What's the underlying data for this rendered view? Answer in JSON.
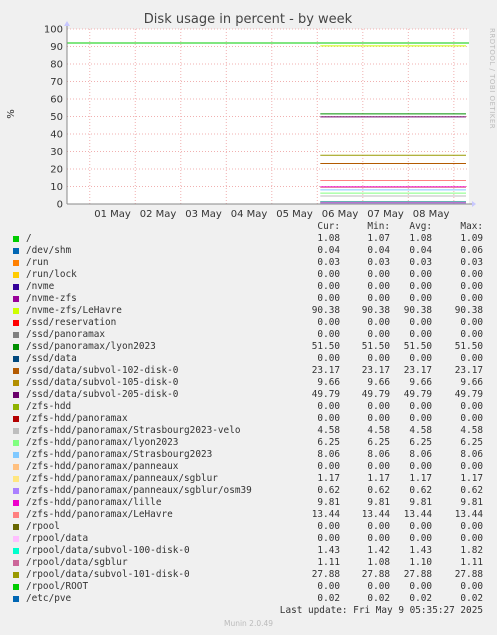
{
  "chart_data": {
    "type": "line",
    "title": "Disk usage in percent - by week",
    "ylabel": "%",
    "side_label": "RRDTOOL / TOBI OETIKER",
    "ylim": [
      0,
      100
    ],
    "y_ticks": [
      0,
      10,
      20,
      30,
      40,
      50,
      60,
      70,
      80,
      90,
      100
    ],
    "x_ticks": [
      "01 May",
      "02 May",
      "03 May",
      "04 May",
      "05 May",
      "06 May",
      "07 May",
      "08 May"
    ],
    "x_range": [
      "30 Apr 12:00",
      "09 May 08:00"
    ],
    "series_start": "06 May",
    "legend_headers": [
      "Cur:",
      "Min:",
      "Avg:",
      "Max:"
    ],
    "series": [
      {
        "name": "/",
        "color": "#00cc00",
        "values": [
          "1.08",
          "1.07",
          "1.08",
          "1.09"
        ]
      },
      {
        "name": "/dev/shm",
        "color": "#0066b3",
        "values": [
          "0.04",
          "0.04",
          "0.04",
          "0.06"
        ]
      },
      {
        "name": "/run",
        "color": "#ff8000",
        "values": [
          "0.03",
          "0.03",
          "0.03",
          "0.03"
        ]
      },
      {
        "name": "/run/lock",
        "color": "#ffcc00",
        "values": [
          "0.00",
          "0.00",
          "0.00",
          "0.00"
        ]
      },
      {
        "name": "/nvme",
        "color": "#330099",
        "values": [
          "0.00",
          "0.00",
          "0.00",
          "0.00"
        ]
      },
      {
        "name": "/nvme-zfs",
        "color": "#990099",
        "values": [
          "0.00",
          "0.00",
          "0.00",
          "0.00"
        ]
      },
      {
        "name": "/nvme-zfs/LeHavre",
        "color": "#ccff00",
        "values": [
          "90.38",
          "90.38",
          "90.38",
          "90.38"
        ]
      },
      {
        "name": "/ssd/reservation",
        "color": "#ff0000",
        "values": [
          "0.00",
          "0.00",
          "0.00",
          "0.00"
        ]
      },
      {
        "name": "/ssd/panoramax",
        "color": "#808080",
        "values": [
          "0.00",
          "0.00",
          "0.00",
          "0.00"
        ]
      },
      {
        "name": "/ssd/panoramax/lyon2023",
        "color": "#008f00",
        "values": [
          "51.50",
          "51.50",
          "51.50",
          "51.50"
        ]
      },
      {
        "name": "/ssd/data",
        "color": "#00487d",
        "values": [
          "0.00",
          "0.00",
          "0.00",
          "0.00"
        ]
      },
      {
        "name": "/ssd/data/subvol-102-disk-0",
        "color": "#b35a00",
        "values": [
          "23.17",
          "23.17",
          "23.17",
          "23.17"
        ]
      },
      {
        "name": "/ssd/data/subvol-105-disk-0",
        "color": "#b38f00",
        "values": [
          "9.66",
          "9.66",
          "9.66",
          "9.66"
        ]
      },
      {
        "name": "/ssd/data/subvol-205-disk-0",
        "color": "#6b006b",
        "values": [
          "49.79",
          "49.79",
          "49.79",
          "49.79"
        ]
      },
      {
        "name": "/zfs-hdd",
        "color": "#8fb300",
        "values": [
          "0.00",
          "0.00",
          "0.00",
          "0.00"
        ]
      },
      {
        "name": "/zfs-hdd/panoramax",
        "color": "#b30000",
        "values": [
          "0.00",
          "0.00",
          "0.00",
          "0.00"
        ]
      },
      {
        "name": "/zfs-hdd/panoramax/Strasbourg2023-velo",
        "color": "#bebebe",
        "values": [
          "4.58",
          "4.58",
          "4.58",
          "4.58"
        ]
      },
      {
        "name": "/zfs-hdd/panoramax/lyon2023",
        "color": "#80ff80",
        "values": [
          "6.25",
          "6.25",
          "6.25",
          "6.25"
        ]
      },
      {
        "name": "/zfs-hdd/panoramax/Strasbourg2023",
        "color": "#80c9ff",
        "values": [
          "8.06",
          "8.06",
          "8.06",
          "8.06"
        ]
      },
      {
        "name": "/zfs-hdd/panoramax/panneaux",
        "color": "#ffc080",
        "values": [
          "0.00",
          "0.00",
          "0.00",
          "0.00"
        ]
      },
      {
        "name": "/zfs-hdd/panoramax/panneaux/sgblur",
        "color": "#ffe680",
        "values": [
          "1.17",
          "1.17",
          "1.17",
          "1.17"
        ]
      },
      {
        "name": "/zfs-hdd/panoramax/panneaux/sgblur/osm39",
        "color": "#aa80ff",
        "values": [
          "0.62",
          "0.62",
          "0.62",
          "0.62"
        ]
      },
      {
        "name": "/zfs-hdd/panoramax/lille",
        "color": "#ee00cc",
        "values": [
          "9.81",
          "9.81",
          "9.81",
          "9.81"
        ]
      },
      {
        "name": "/zfs-hdd/panoramax/LeHavre",
        "color": "#ff8080",
        "values": [
          "13.44",
          "13.44",
          "13.44",
          "13.44"
        ]
      },
      {
        "name": "/rpool",
        "color": "#666600",
        "values": [
          "0.00",
          "0.00",
          "0.00",
          "0.00"
        ]
      },
      {
        "name": "/rpool/data",
        "color": "#ffbfff",
        "values": [
          "0.00",
          "0.00",
          "0.00",
          "0.00"
        ]
      },
      {
        "name": "/rpool/data/subvol-100-disk-0",
        "color": "#00ffcc",
        "values": [
          "1.43",
          "1.42",
          "1.43",
          "1.82"
        ]
      },
      {
        "name": "/rpool/data/sgblur",
        "color": "#cc6699",
        "values": [
          "1.11",
          "1.08",
          "1.10",
          "1.11"
        ]
      },
      {
        "name": "/rpool/data/subvol-101-disk-0",
        "color": "#999900",
        "values": [
          "27.88",
          "27.88",
          "27.88",
          "27.88"
        ]
      },
      {
        "name": "/rpool/ROOT",
        "color": "#00cc00",
        "values": [
          "0.00",
          "0.00",
          "0.00",
          "0.00"
        ]
      },
      {
        "name": "/etc/pve",
        "color": "#0066b3",
        "values": [
          "0.02",
          "0.02",
          "0.02",
          "0.02"
        ]
      }
    ],
    "grid": true,
    "legend_placement": "below"
  },
  "last_update": "Last update: Fri May  9 05:35:27 2025",
  "footer": "Munin 2.0.49"
}
